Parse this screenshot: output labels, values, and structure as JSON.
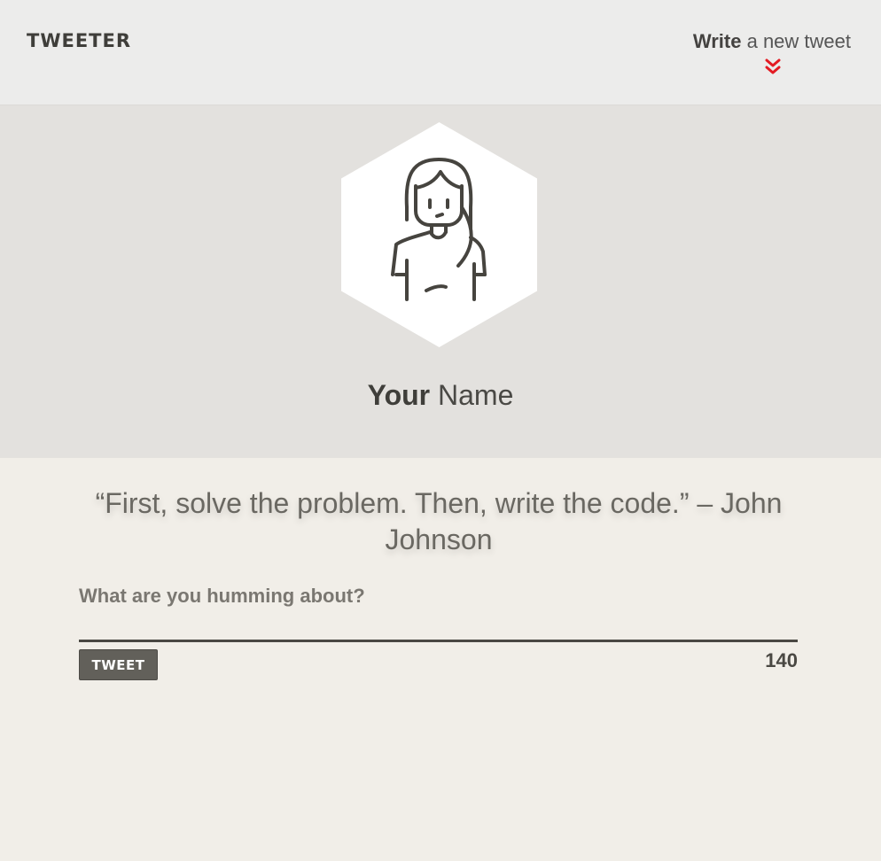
{
  "header": {
    "logo": "TWEETER",
    "write_strong": "Write",
    "write_light": " a new tweet",
    "chevron_icon": "double-chevron-down-icon",
    "chevron_color": "#e31b23"
  },
  "profile": {
    "avatar_icon": "woman-avatar-icon",
    "name_strong": "Your",
    "name_light": " Name"
  },
  "quote": {
    "text": "“First, solve the problem. Then, write the code.” – John Johnson"
  },
  "composer": {
    "label": "What are you humming about?",
    "input_value": "",
    "button_label": "TWEET",
    "char_count": "140"
  }
}
